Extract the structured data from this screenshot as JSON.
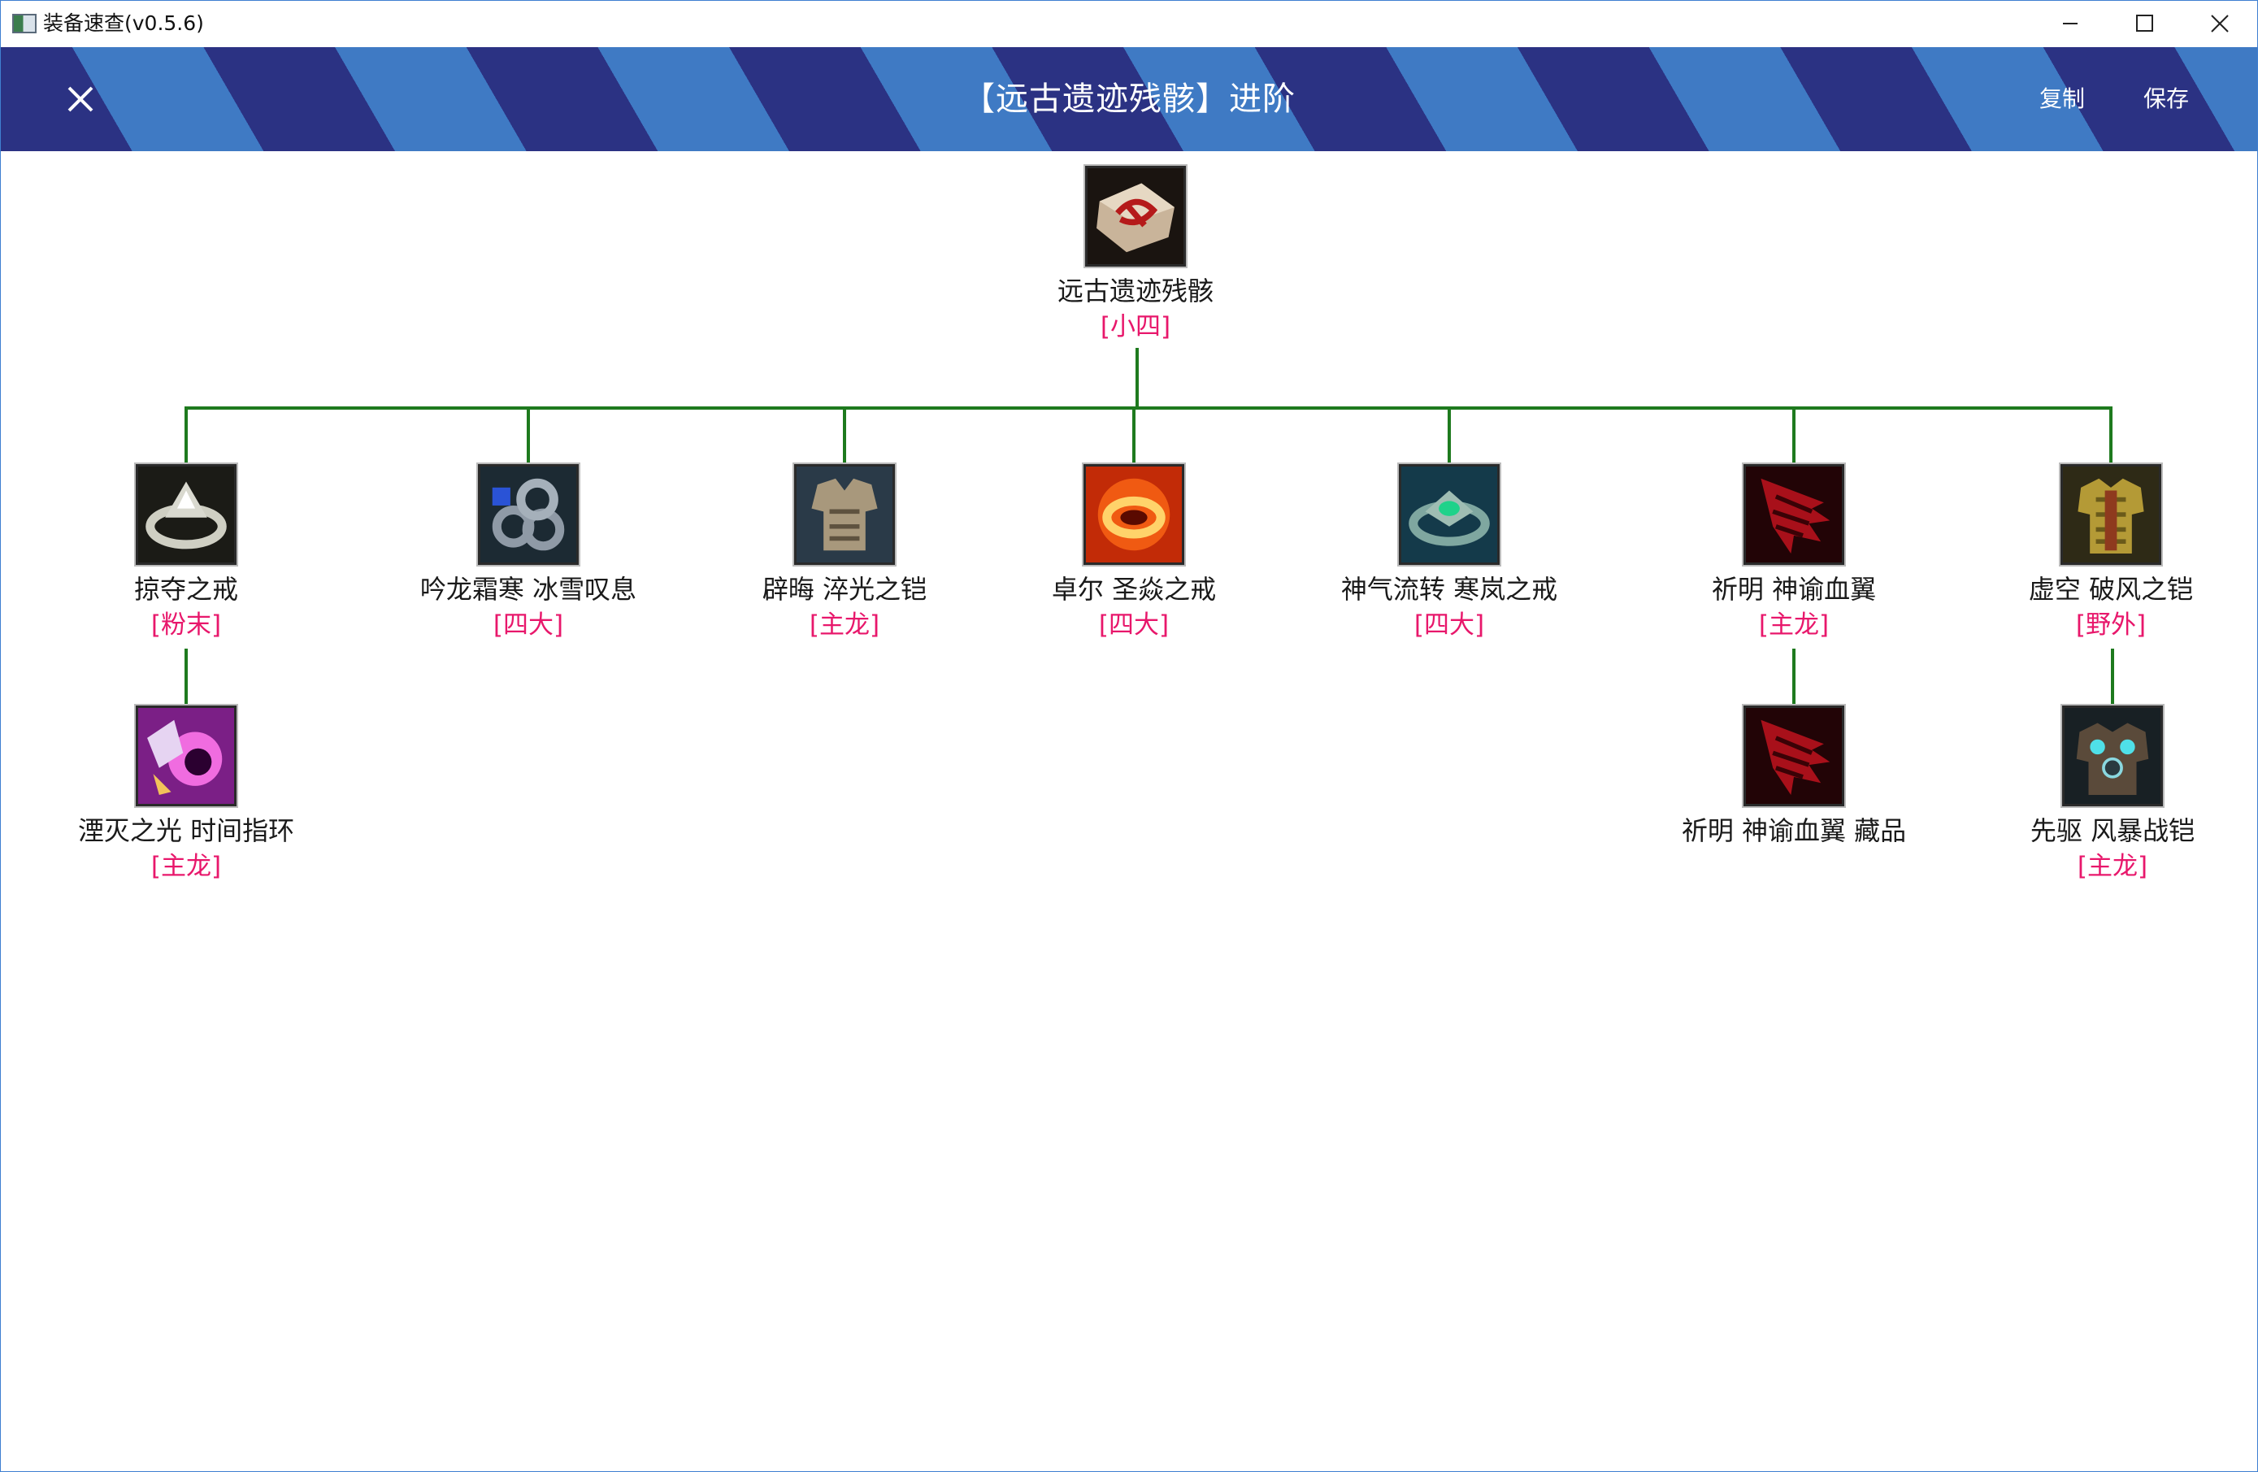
{
  "window": {
    "title": "装备速查(v0.5.6)"
  },
  "banner": {
    "title": "【远古遗迹残骸】进阶",
    "copy_label": "复制",
    "save_label": "保存"
  },
  "colors": {
    "banner_dark": "#2b3283",
    "banner_light": "#3f7ac4",
    "connector": "#1e7a1e",
    "tag": "#e8176b"
  },
  "tree": {
    "root": {
      "name": "远古遗迹残骸",
      "tag": "[小四]",
      "icon": "stone-rune-icon"
    },
    "children": [
      {
        "name": "掠夺之戒",
        "tag": "[粉末]",
        "icon": "silver-ring-icon",
        "child": {
          "name": "湮灭之光 时间指环",
          "tag": "[主龙]",
          "icon": "pink-portal-ring-icon"
        }
      },
      {
        "name": "吟龙霜寒 冰雪叹息",
        "tag": "[四大]",
        "icon": "frost-gem-ring-icon"
      },
      {
        "name": "辟晦 淬光之铠",
        "tag": "[主龙]",
        "icon": "plate-armor-icon"
      },
      {
        "name": "卓尔 圣焱之戒",
        "tag": "[四大]",
        "icon": "fire-ring-icon"
      },
      {
        "name": "神气流转 寒岚之戒",
        "tag": "[四大]",
        "icon": "emerald-ring-icon"
      },
      {
        "name": "祈明 神谕血翼",
        "tag": "[主龙]",
        "icon": "crimson-wing-icon",
        "child": {
          "name": "祈明 神谕血翼 藏品",
          "tag": "",
          "icon": "crimson-wing-icon"
        }
      },
      {
        "name": "虚空 破风之铠",
        "tag": "[野外]",
        "icon": "golden-armor-icon",
        "child": {
          "name": "先驱 风暴战铠",
          "tag": "[主龙]",
          "icon": "storm-armor-icon"
        }
      }
    ]
  }
}
